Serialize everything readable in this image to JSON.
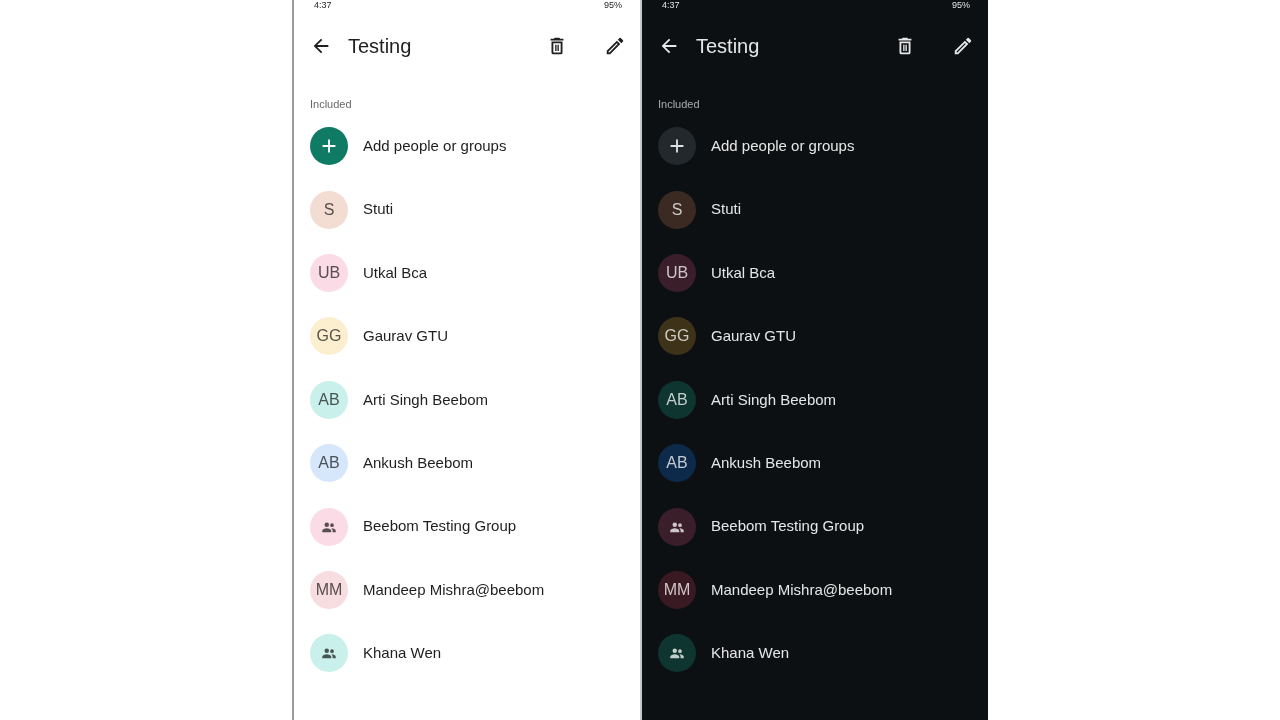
{
  "screens": [
    {
      "dark_mode": false,
      "status_bar": {
        "time": "4:37",
        "battery": "95%"
      },
      "title": "Testing",
      "section_label": "Included",
      "add_label": "Add people or groups",
      "contacts": [
        {
          "kind": "initials",
          "initials": "S",
          "name": "Stuti",
          "color": "#f3dcd2"
        },
        {
          "kind": "initials",
          "initials": "UB",
          "name": "Utkal Bca",
          "color": "#fadbe6"
        },
        {
          "kind": "initials",
          "initials": "GG",
          "name": "Gaurav GTU",
          "color": "#fbefd0"
        },
        {
          "kind": "initials",
          "initials": "AB",
          "name": "Arti Singh Beebom",
          "color": "#c9f0ea"
        },
        {
          "kind": "initials",
          "initials": "AB",
          "name": "Ankush Beebom",
          "color": "#d6e7fb"
        },
        {
          "kind": "group",
          "name": "Beebom Testing Group",
          "color": "#fadbe6"
        },
        {
          "kind": "initials",
          "initials": "MM",
          "name": "Mandeep Mishra@beebom",
          "color": "#f8dde0"
        },
        {
          "kind": "group",
          "name": "Khana Wen",
          "color": "#c9f0ea"
        }
      ]
    },
    {
      "dark_mode": true,
      "status_bar": {
        "time": "4:37",
        "battery": "95%"
      },
      "title": "Testing",
      "section_label": "Included",
      "add_label": "Add people or groups",
      "contacts": [
        {
          "kind": "initials",
          "initials": "S",
          "name": "Stuti",
          "color": "#3a2a22"
        },
        {
          "kind": "initials",
          "initials": "UB",
          "name": "Utkal Bca",
          "color": "#3a1e2a"
        },
        {
          "kind": "initials",
          "initials": "GG",
          "name": "Gaurav GTU",
          "color": "#3e3218"
        },
        {
          "kind": "initials",
          "initials": "AB",
          "name": "Arti Singh Beebom",
          "color": "#0e3530"
        },
        {
          "kind": "initials",
          "initials": "AB",
          "name": "Ankush Beebom",
          "color": "#0e2a4a"
        },
        {
          "kind": "group",
          "name": "Beebom Testing Group",
          "color": "#3a1e2a"
        },
        {
          "kind": "initials",
          "initials": "MM",
          "name": "Mandeep Mishra@beebom",
          "color": "#3a1a22"
        },
        {
          "kind": "group",
          "name": "Khana Wen",
          "color": "#0e3530"
        }
      ]
    }
  ]
}
